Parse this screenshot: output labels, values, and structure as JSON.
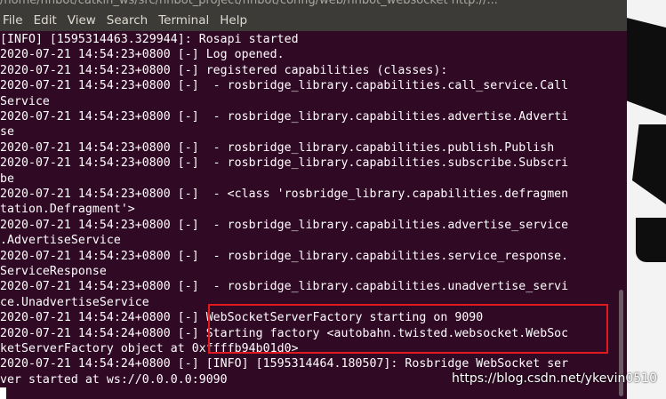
{
  "window": {
    "title_fragment": "/home/nnbot/catkin_ws/src/nnbot_project/nnbot/config/web/nnbot_websocket http://..."
  },
  "menu": [
    "File",
    "Edit",
    "View",
    "Search",
    "Terminal",
    "Help"
  ],
  "terminal_lines": [
    "[INFO] [1595314463.329944]: Rosapi started",
    "2020-07-21 14:54:23+0800 [-] Log opened.",
    "2020-07-21 14:54:23+0800 [-] registered capabilities (classes):",
    "2020-07-21 14:54:23+0800 [-]  - rosbridge_library.capabilities.call_service.Call",
    "Service",
    "2020-07-21 14:54:23+0800 [-]  - rosbridge_library.capabilities.advertise.Adverti",
    "se",
    "2020-07-21 14:54:23+0800 [-]  - rosbridge_library.capabilities.publish.Publish",
    "2020-07-21 14:54:23+0800 [-]  - rosbridge_library.capabilities.subscribe.Subscri",
    "be",
    "2020-07-21 14:54:23+0800 [-]  - <class 'rosbridge_library.capabilities.defragmen",
    "tation.Defragment'>",
    "2020-07-21 14:54:23+0800 [-]  - rosbridge_library.capabilities.advertise_service",
    ".AdvertiseService",
    "2020-07-21 14:54:23+0800 [-]  - rosbridge_library.capabilities.service_response.",
    "ServiceResponse",
    "2020-07-21 14:54:23+0800 [-]  - rosbridge_library.capabilities.unadvertise_servi",
    "ce.UnadvertiseService",
    "2020-07-21 14:54:24+0800 [-] WebSocketServerFactory starting on 9090",
    "2020-07-21 14:54:24+0800 [-] Starting factory <autobahn.twisted.websocket.WebSoc",
    "ketServerFactory object at 0xffffb94b01d0>",
    "2020-07-21 14:54:24+0800 [-] [INFO] [1595314464.180507]: Rosbridge WebSocket ser",
    "ver started at ws://0.0.0.0:9090"
  ],
  "watermark": "https://blog.csdn.net/ykevin0510",
  "colors": {
    "terminal_bg": "#300a24",
    "menubar_bg": "#3c3b37",
    "text": "#ffffff",
    "highlight": "#e0191e"
  }
}
